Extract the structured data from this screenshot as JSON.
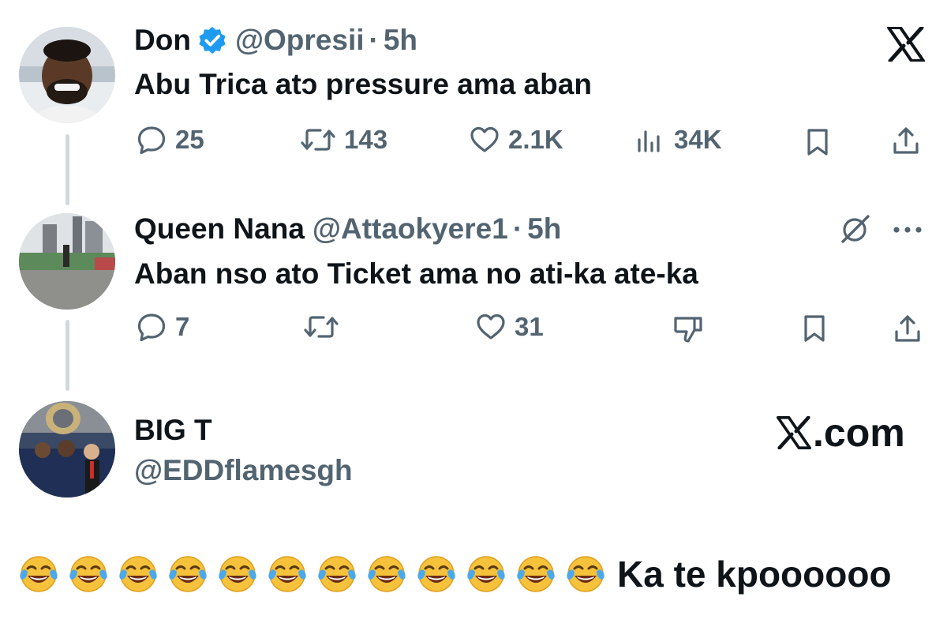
{
  "tweet1": {
    "name": "Don",
    "handle": "@Opresii",
    "separator": "·",
    "time": "5h",
    "text": "Abu Trica atɔ pressure ama aban",
    "replies": "25",
    "reposts": "143",
    "likes": "2.1K",
    "views": "34K"
  },
  "tweet2": {
    "name": "Queen Nana",
    "handle": "@Attaokyere1",
    "separator": "·",
    "time": "5h",
    "text": "Aban nso ato Ticket ama no ati-ka ate-ka",
    "replies": "7",
    "reposts": "",
    "likes": "31"
  },
  "quote": {
    "name": "BIG T",
    "handle": "@EDDflamesgh",
    "site_label": ".com",
    "emoji_count": 12,
    "emoji": "face-with-tears-of-joy",
    "text": "Ka te kpoooooo"
  },
  "icons": {
    "verified": "verified-badge-icon",
    "x_logo": "x-logo-icon",
    "reply": "reply-icon",
    "repost": "repost-icon",
    "like": "heart-icon",
    "views": "views-icon",
    "bookmark": "bookmark-icon",
    "share": "share-icon",
    "grok": "grok-icon",
    "more": "more-icon",
    "dislike": "dislike-icon"
  },
  "colors": {
    "text": "#0f1419",
    "muted": "#536471",
    "verified": "#1d9bf0",
    "thread_line": "#cfd9de"
  }
}
